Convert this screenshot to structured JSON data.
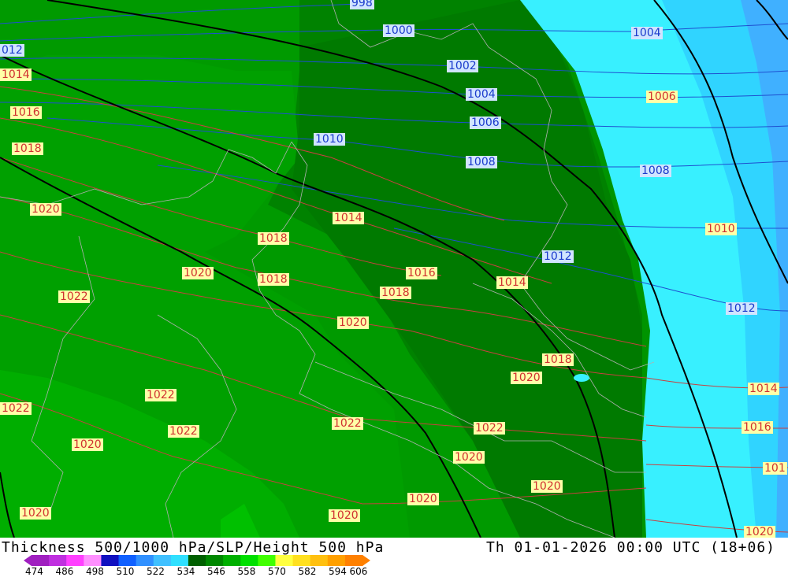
{
  "title": "Thickness 500/1000 hPa/SLP/Height 500 hPa",
  "datetime": "Th 01-01-2026 00:00 UTC (18+06)",
  "legend": {
    "ticks": [
      "474",
      "486",
      "498",
      "510",
      "522",
      "534",
      "546",
      "558",
      "570",
      "582",
      "594",
      "606"
    ],
    "colors": [
      "#a020c0",
      "#c030e0",
      "#ff40ff",
      "#ff90ff",
      "#1010c0",
      "#1060ff",
      "#3090ff",
      "#40c0ff",
      "#30e0ff",
      "#006000",
      "#008800",
      "#00b000",
      "#00e000",
      "#40ff00",
      "#ffff40",
      "#ffe020",
      "#ffc010",
      "#ffa000",
      "#ff8000"
    ]
  },
  "slp_labels": [
    {
      "text": "998",
      "color": "blue"
    },
    {
      "text": "1000",
      "color": "blue"
    },
    {
      "text": "1002",
      "color": "blue"
    },
    {
      "text": "1004",
      "color": "blue"
    },
    {
      "text": "1006",
      "color": "blue"
    },
    {
      "text": "1008",
      "color": "blue"
    },
    {
      "text": "1010",
      "color": "blue"
    },
    {
      "text": "1012",
      "color": "blue"
    },
    {
      "text": "012",
      "color": "blue"
    },
    {
      "text": "1004",
      "color": "blue"
    },
    {
      "text": "1006",
      "color": "red"
    },
    {
      "text": "1008",
      "color": "blue"
    },
    {
      "text": "1010",
      "color": "red"
    },
    {
      "text": "1012",
      "color": "blue"
    },
    {
      "text": "1014",
      "color": "red"
    },
    {
      "text": "1014",
      "color": "red"
    },
    {
      "text": "1016",
      "color": "red"
    },
    {
      "text": "1018",
      "color": "red"
    },
    {
      "text": "1020",
      "color": "red"
    },
    {
      "text": "1018",
      "color": "red"
    },
    {
      "text": "1018",
      "color": "red"
    },
    {
      "text": "1020",
      "color": "red"
    },
    {
      "text": "1022",
      "color": "red"
    },
    {
      "text": "1016",
      "color": "red"
    },
    {
      "text": "1018",
      "color": "red"
    },
    {
      "text": "1014",
      "color": "red"
    },
    {
      "text": "1020",
      "color": "red"
    },
    {
      "text": "1018",
      "color": "red"
    },
    {
      "text": "1020",
      "color": "red"
    },
    {
      "text": "1022",
      "color": "red"
    },
    {
      "text": "1022",
      "color": "red"
    },
    {
      "text": "1022",
      "color": "red"
    },
    {
      "text": "1020",
      "color": "red"
    },
    {
      "text": "1022",
      "color": "red"
    },
    {
      "text": "1022",
      "color": "red"
    },
    {
      "text": "1020",
      "color": "red"
    },
    {
      "text": "1020",
      "color": "red"
    },
    {
      "text": "1020",
      "color": "red"
    },
    {
      "text": "1020",
      "color": "red"
    },
    {
      "text": "1020",
      "color": "red"
    },
    {
      "text": "1014",
      "color": "red"
    },
    {
      "text": "1016",
      "color": "red"
    },
    {
      "text": "101",
      "color": "red"
    },
    {
      "text": "1020",
      "color": "red"
    },
    {
      "text": "1012",
      "color": "blue"
    }
  ]
}
